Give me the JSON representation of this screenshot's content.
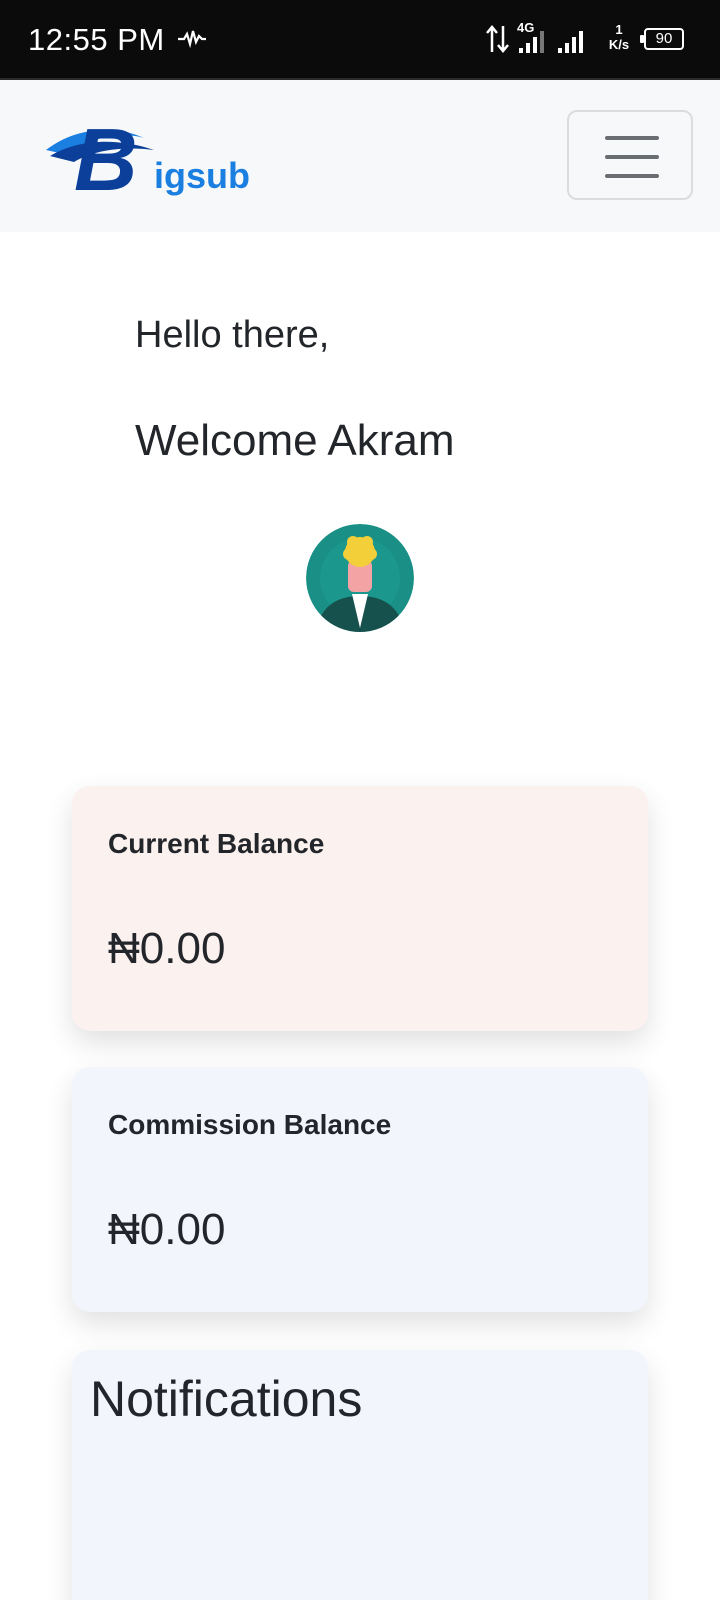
{
  "status_bar": {
    "time": "12:55 PM",
    "network_type": "4G",
    "speed_value": "1",
    "speed_unit": "K/s",
    "battery": "90"
  },
  "header": {
    "logo_text": "igsub",
    "logo_letter": "B",
    "colors": {
      "brand_dark": "#0b3f99",
      "brand_light": "#1a7fe0"
    }
  },
  "greeting": {
    "line1": "Hello there,",
    "line2": "Welcome Akram"
  },
  "cards": {
    "current_balance": {
      "label": "Current Balance",
      "amount": "₦0.00"
    },
    "commission_balance": {
      "label": "Commission Balance",
      "amount": "₦0.00"
    },
    "notifications": {
      "title": "Notifications"
    }
  }
}
